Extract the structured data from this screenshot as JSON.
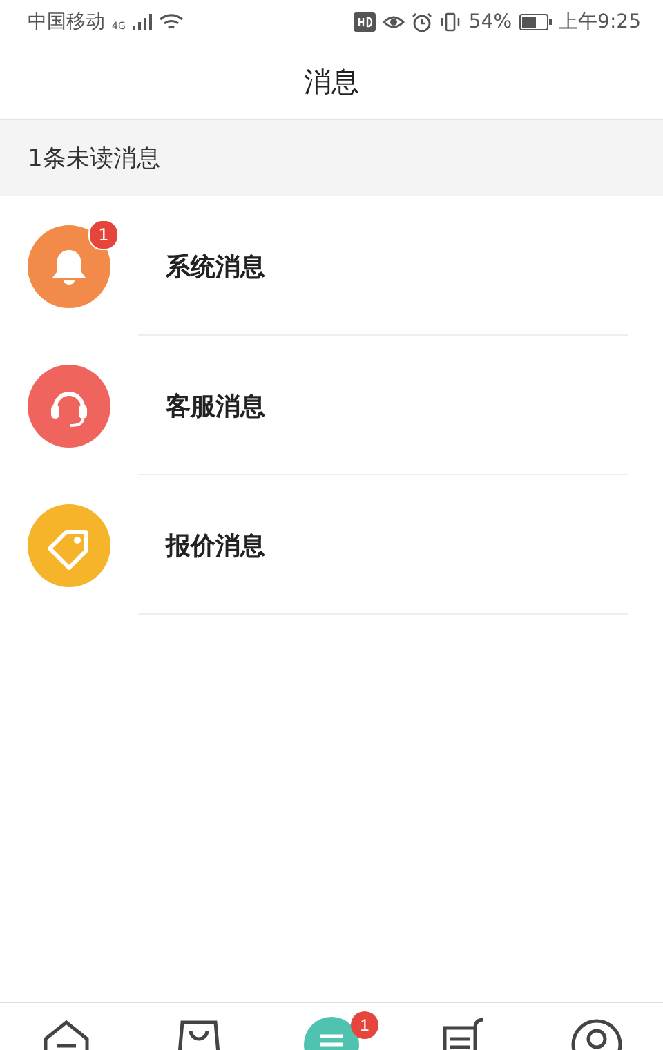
{
  "status_bar": {
    "carrier": "中国移动",
    "network": "4G",
    "battery": "54%",
    "time": "上午9:25"
  },
  "header": {
    "title": "消息"
  },
  "unread_summary": "1条未读消息",
  "messages": [
    {
      "kind": "bell",
      "label": "系统消息",
      "color": "#f28a4a",
      "badge": "1"
    },
    {
      "kind": "headset",
      "label": "客服消息",
      "color": "#f0645e"
    },
    {
      "kind": "tag",
      "label": "报价消息",
      "color": "#f6b42a"
    }
  ],
  "tab_bar": [
    {
      "kind": "home",
      "selected": false
    },
    {
      "kind": "bag",
      "selected": false
    },
    {
      "kind": "message",
      "selected": true,
      "badge": "1"
    },
    {
      "kind": "list",
      "selected": false
    },
    {
      "kind": "user",
      "selected": false
    }
  ]
}
